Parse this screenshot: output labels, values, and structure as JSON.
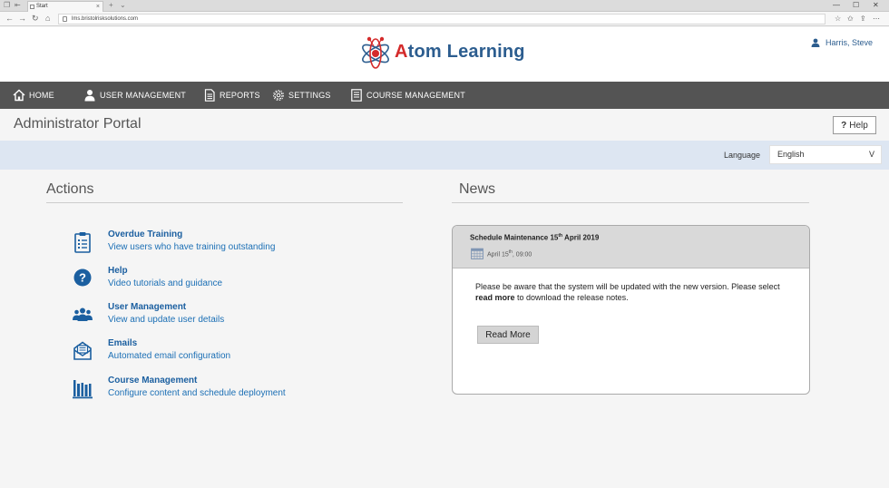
{
  "browser": {
    "tab_title": "Start",
    "tab_close": "×",
    "new_tab": "+",
    "tab_menu": "⌄",
    "url": "lms.bristolrisksolutions.com",
    "win_min": "—",
    "win_max": "☐",
    "win_close": "✕",
    "back": "←",
    "forward": "→",
    "reload": "↻",
    "home": "⌂",
    "fav_star": "☆",
    "favorites": "✩",
    "share": "⇪",
    "more": "⋯"
  },
  "header": {
    "logo_first_letter": "A",
    "logo_rest": "tom Learning",
    "user_name": "Harris, Steve"
  },
  "nav": {
    "items": [
      {
        "label": "HOME",
        "icon": "home-icon"
      },
      {
        "label": "USER MANAGEMENT",
        "icon": "user-icon"
      },
      {
        "label": "REPORTS",
        "icon": "document-icon"
      },
      {
        "label": "SETTINGS",
        "icon": "gear-icon"
      },
      {
        "label": "COURSE MANAGEMENT",
        "icon": "book-icon"
      }
    ]
  },
  "page": {
    "title": "Administrator Portal",
    "help_symbol": "?",
    "help_label": "Help"
  },
  "language": {
    "label": "Language",
    "selected": "English",
    "caret": "V"
  },
  "actions": {
    "title": "Actions",
    "items": [
      {
        "title": "Overdue Training",
        "subtitle": "View users who have training outstanding",
        "icon": "clipboard-icon"
      },
      {
        "title": "Help",
        "subtitle": "Video tutorials and guidance",
        "icon": "question-icon"
      },
      {
        "title": "User Management",
        "subtitle": "View and update user details",
        "icon": "users-icon"
      },
      {
        "title": "Emails",
        "subtitle": "Automated email configuration",
        "icon": "email-icon"
      },
      {
        "title": "Course Management",
        "subtitle": "Configure content and schedule deployment",
        "icon": "books-icon"
      }
    ]
  },
  "news": {
    "title": "News",
    "card": {
      "title_prefix": "Schedule Maintenance 15",
      "title_sup": "th",
      "title_suffix": " April 2019",
      "date_prefix": "April 15",
      "date_sup": "th",
      "date_suffix": ", 09:00",
      "body_1": "Please be aware that the system will be updated with the new version. Please select ",
      "body_bold": "read more",
      "body_2": " to download the release notes.",
      "read_more": "Read More"
    }
  },
  "colors": {
    "nav_bg": "#545454",
    "accent_blue": "#1b5fa0",
    "logo_red": "#d42b2b",
    "lang_strip": "#dde6f2"
  }
}
